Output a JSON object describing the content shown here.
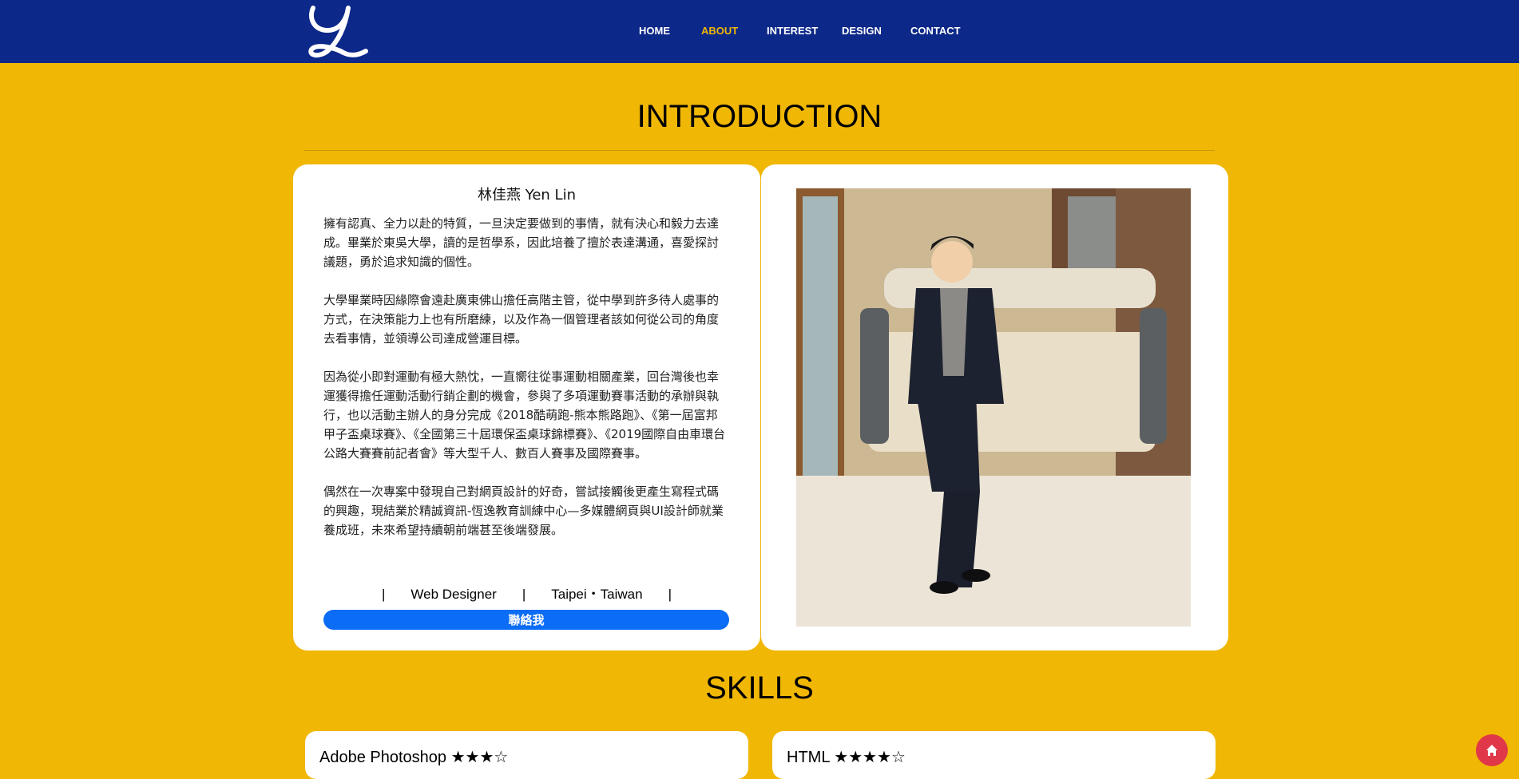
{
  "nav": {
    "logo_text": "Y",
    "items": [
      {
        "label": "HOME",
        "active": false
      },
      {
        "label": "ABOUT",
        "active": true
      },
      {
        "label": "INTEREST",
        "active": false
      },
      {
        "label": "DESIGN",
        "active": false
      },
      {
        "label": "CONTACT",
        "active": false
      }
    ]
  },
  "intro": {
    "title": "INTRODUCTION",
    "name": "林佳燕  Yen Lin",
    "paragraphs": [
      "擁有認真、全力以赴的特質，一旦決定要做到的事情，就有決心和毅力去達成。畢業於東吳大學，讀的是哲學系，因此培養了擅於表達溝通，喜愛探討議題，勇於追求知識的個性。",
      "大學畢業時因緣際會遠赴廣東佛山擔任高階主管，從中學到許多待人處事的方式，在決策能力上也有所磨練，以及作為一個管理者該如何從公司的角度去看事情，並領導公司達成營運目標。",
      "因為從小即對運動有極大熱忱，一直嚮往從事運動相關產業，回台灣後也幸運獲得擔任運動活動行銷企劃的機會，參與了多項運動賽事活動的承辦與執行，也以活動主辦人的身分完成《2018酷萌跑-熊本熊路跑》、《第一屆富邦甲子盃桌球賽》、《全國第三十屆環保盃桌球錦標賽》、《2019國際自由車環台公路大賽賽前記者會》等大型千人、數百人賽事及國際賽事。",
      "偶然在一次專案中發現自己對網頁設計的好奇，嘗試接觸後更產生寫程式碼的興趣，現結業於精誠資訊-恆逸教育訓練中心—多媒體網頁與UI設計師就業養成班，未來希望持續朝前端甚至後端發展。"
    ],
    "separator": "|",
    "role": "Web Designer",
    "location": "Taipei・Taiwan",
    "contact_button": "聯絡我"
  },
  "skills": {
    "title": "SKILLS",
    "items": [
      {
        "label": "Adobe Photoshop   ★★★☆"
      },
      {
        "label": "HTML ★★★★☆"
      }
    ]
  },
  "colors": {
    "navbar": "#0c2888",
    "background": "#f0b705",
    "accent": "#f0b705",
    "button": "#0b6cf5",
    "fab": "#e03848"
  },
  "icons": {
    "home_fab": "home-icon"
  }
}
